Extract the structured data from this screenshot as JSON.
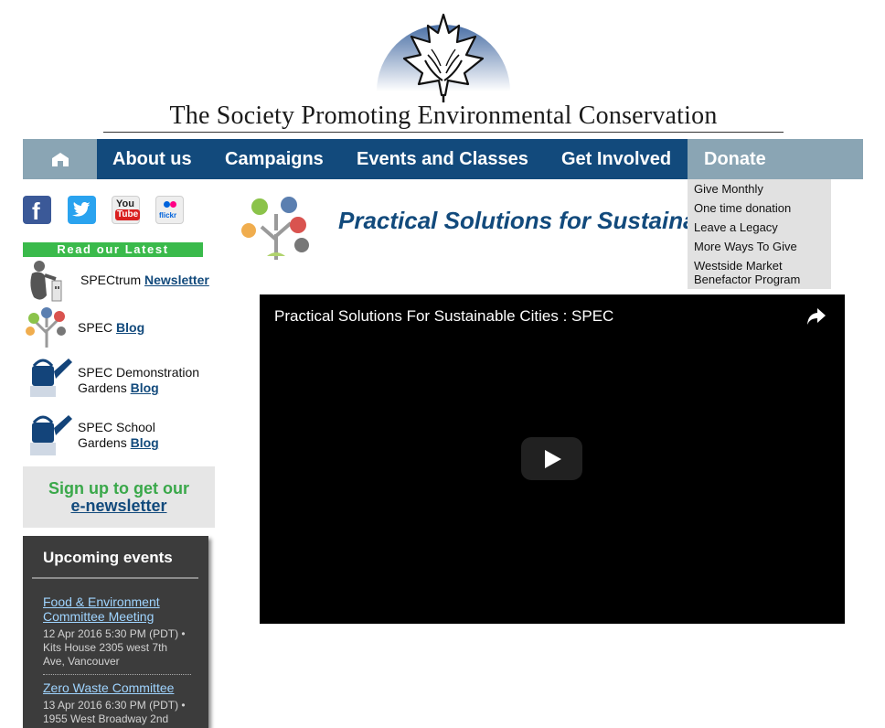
{
  "header": {
    "site_title": "The Society Promoting Environmental Conservation"
  },
  "nav": {
    "home_icon": "home-icon",
    "items": [
      "About us",
      "Campaigns",
      "Events and Classes",
      "Get Involved",
      "Donate"
    ],
    "donate_dropdown": [
      "Give Monthly",
      "One time donation",
      "Leave a Legacy",
      "More Ways To Give",
      "Westside Market",
      "Benefactor Program"
    ]
  },
  "social": {
    "facebook": "f",
    "twitter": "twitter-icon",
    "youtube_you": "You",
    "youtube_tube": "Tube",
    "flickr": "flickr"
  },
  "sidebar": {
    "latest_heading": "Read our Latest",
    "items": [
      {
        "text": "SPECtrum",
        "link": "Newsletter"
      },
      {
        "text": "SPEC",
        "link": "Blog"
      },
      {
        "text_1": "SPEC Demonstration",
        "text_2": "Gardens",
        "link": "Blog"
      },
      {
        "text_1": "SPEC School",
        "text_2": "Gardens",
        "link": "Blog"
      }
    ],
    "signup_line1": "Sign up to get our",
    "signup_link": "e-newsletter"
  },
  "events": {
    "title": "Upcoming events",
    "list": [
      {
        "title_1": "Food & Environment",
        "title_2": "Committee Meeting",
        "meta_1": "12 Apr 2016 5:30 PM (PDT) •",
        "meta_2": "Kits House 2305 west 7th",
        "meta_3": "Ave, Vancouver"
      },
      {
        "title_1": "Zero Waste Committee",
        "meta_1": "13 Apr 2016 6:30 PM (PDT) •",
        "meta_2": "1955 West Broadway 2nd"
      }
    ]
  },
  "main": {
    "tagline": "Practical Solutions for Sustainable Cities",
    "video_title": "Practical Solutions For Sustainable Cities : SPEC"
  },
  "colors": {
    "nav_dark": "#124a7c",
    "nav_light": "#8aa5b4",
    "green": "#3aba4b"
  }
}
